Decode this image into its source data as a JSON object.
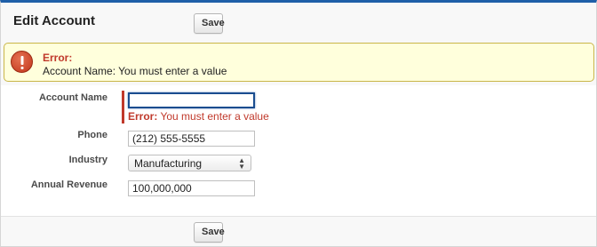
{
  "header": {
    "title": "Edit Account",
    "save_label": "Save"
  },
  "error_box": {
    "title": "Error:",
    "message": "Account Name: You must enter a value"
  },
  "form": {
    "account_name": {
      "label": "Account Name",
      "value": "",
      "error_prefix": "Error:",
      "error_text": " You must enter a value"
    },
    "phone": {
      "label": "Phone",
      "value": "(212) 555-5555"
    },
    "industry": {
      "label": "Industry",
      "value": "Manufacturing"
    },
    "annual_revenue": {
      "label": "Annual Revenue",
      "value": "100,000,000"
    }
  },
  "footer": {
    "save_label": "Save"
  },
  "colors": {
    "accent_blue": "#1f5fa8",
    "error_red": "#c0392b",
    "error_bg": "#ffffdc"
  },
  "icons": {
    "error": "error-icon",
    "select_arrows": "select-arrows-icon"
  }
}
